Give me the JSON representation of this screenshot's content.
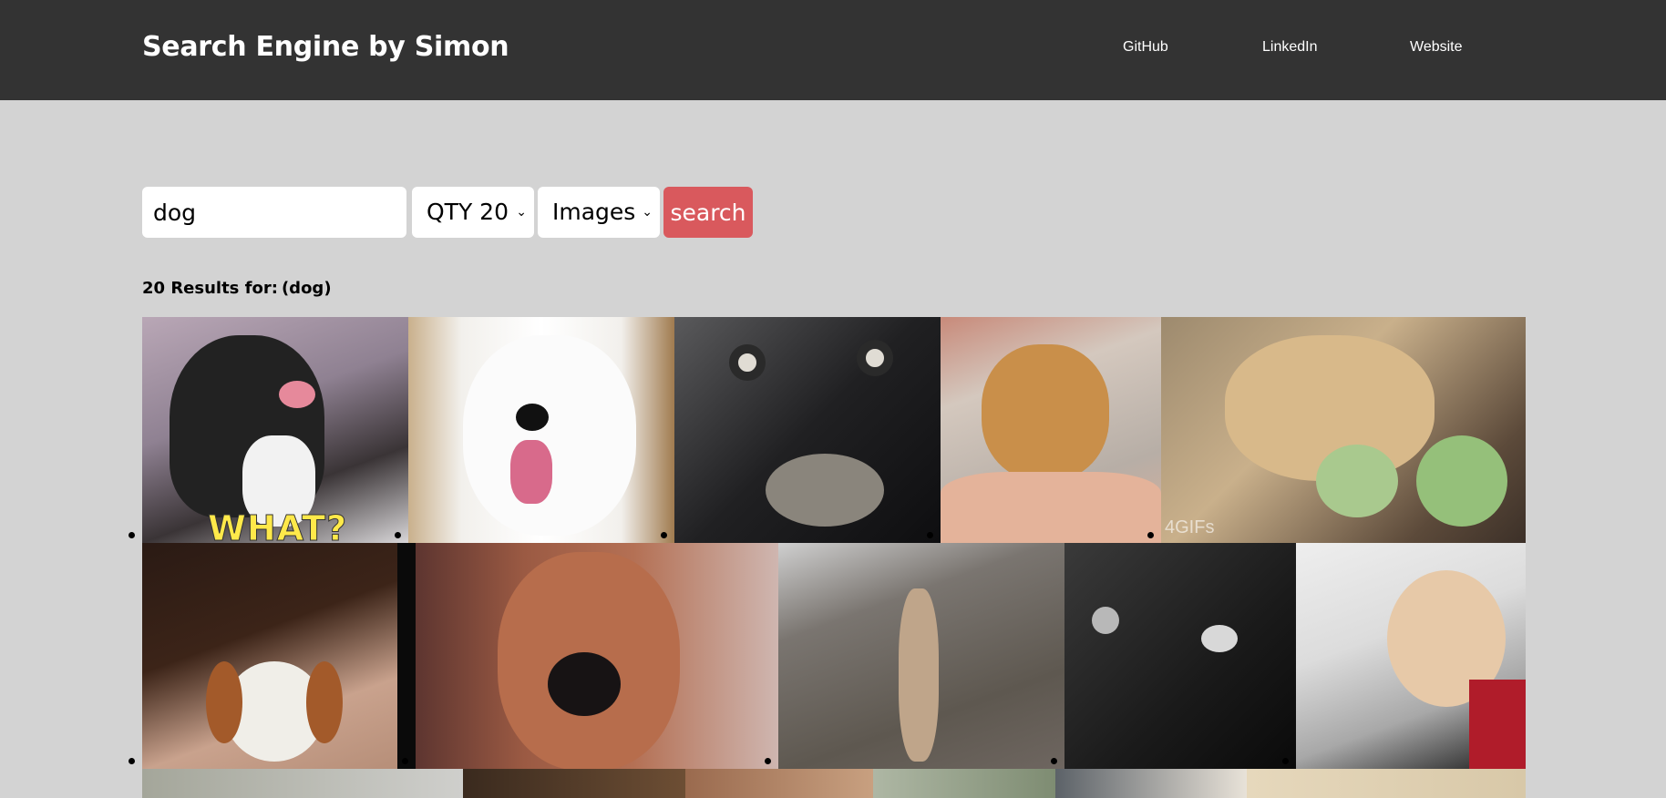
{
  "header": {
    "brand": "Search Engine by Simon",
    "links": [
      "GitHub",
      "LinkedIn",
      "Website"
    ]
  },
  "search": {
    "query": "dog",
    "quantity_selected": "QTY 20",
    "type_selected": "Images",
    "button_label": "search"
  },
  "results": {
    "summary_prefix": "20 Results for:",
    "summary_query": "(dog)"
  },
  "images": [
    {
      "subject": "black-and-white dog with tongue out",
      "caption_text": "WHAT?"
    },
    {
      "subject": "white samoyed smiling"
    },
    {
      "subject": "black dog wide eyes"
    },
    {
      "subject": "golden puppy being petted"
    },
    {
      "subject": "corgi with cabbage",
      "caption_text": "4GIFs"
    },
    {
      "subject": "beagle peeking"
    },
    {
      "subject": "dachshund close-up"
    },
    {
      "subject": "small dog standing on hind legs"
    },
    {
      "subject": "black dog startled"
    },
    {
      "subject": "puppy on pillow"
    },
    {
      "subject": "dog row three image 1"
    },
    {
      "subject": "dog row three image 2"
    },
    {
      "subject": "dog row three image 3"
    },
    {
      "subject": "dog row three image 4"
    },
    {
      "subject": "dog row three image 5"
    },
    {
      "subject": "dog row three image 6"
    }
  ],
  "colors": {
    "navbar": "#333333",
    "page_bg": "#d3d3d3",
    "search_button": "#d9595d"
  }
}
